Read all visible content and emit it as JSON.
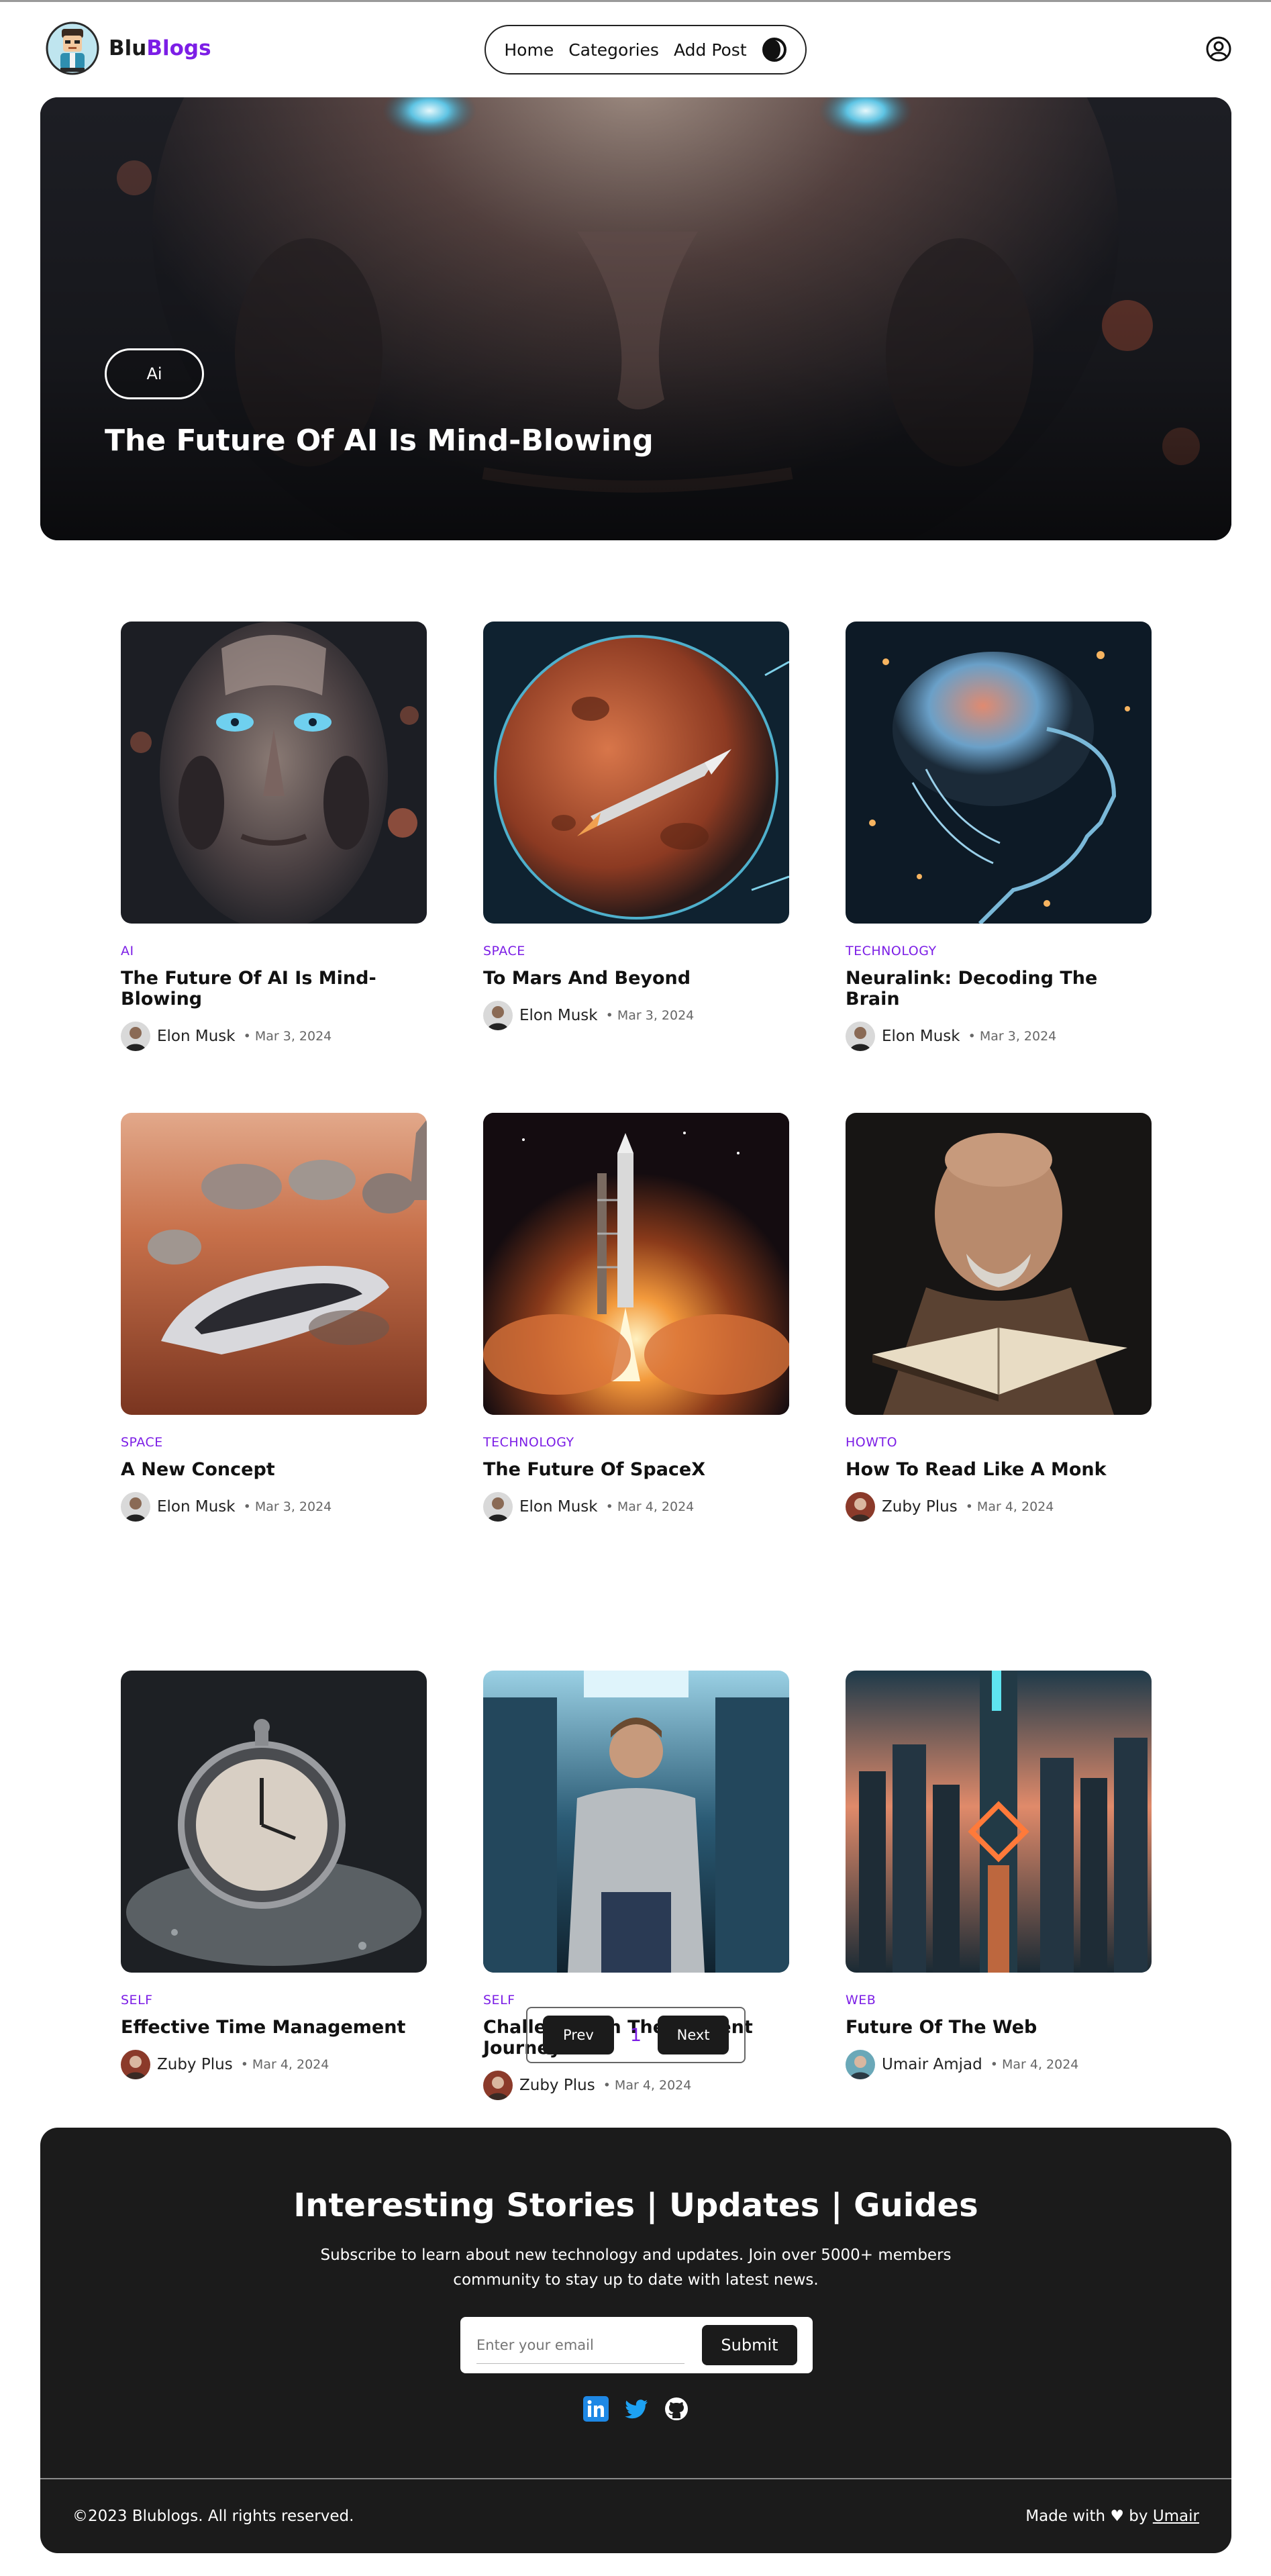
{
  "brand": {
    "name_part1": "Blu",
    "name_part2": "Blogs",
    "accent": "#7c1ee6"
  },
  "nav": {
    "links": [
      "Home",
      "Categories",
      "Add Post"
    ],
    "theme_icon": "dark-mode-icon",
    "user_icon": "user-circle-icon"
  },
  "hero": {
    "badge": "Ai",
    "title": "The Future Of AI Is Mind-Blowing"
  },
  "posts": [
    {
      "category": "AI",
      "title": "The Future Of AI Is Mind-Blowing",
      "author": "Elon Musk",
      "date": "• Mar 3, 2024"
    },
    {
      "category": "SPACE",
      "title": "To Mars And Beyond",
      "author": "Elon Musk",
      "date": "• Mar 3, 2024"
    },
    {
      "category": "TECHNOLOGY",
      "title": "Neuralink: Decoding The Brain",
      "author": "Elon Musk",
      "date": "• Mar 3, 2024"
    },
    {
      "category": "SPACE",
      "title": "A New Concept",
      "author": "Elon Musk",
      "date": "• Mar 3, 2024"
    },
    {
      "category": "TECHNOLOGY",
      "title": "The Future Of SpaceX",
      "author": "Elon Musk",
      "date": "• Mar 4, 2024"
    },
    {
      "category": "HOWTO",
      "title": "How To Read Like A Monk",
      "author": "Zuby Plus",
      "date": "• Mar 4, 2024"
    },
    {
      "category": "SELF",
      "title": "Effective Time Management",
      "author": "Zuby Plus",
      "date": "• Mar 4, 2024"
    },
    {
      "category": "SELF",
      "title": "Challenges In The Student Journey",
      "author": "Zuby Plus",
      "date": "• Mar 4, 2024"
    },
    {
      "category": "WEB",
      "title": "Future Of The Web",
      "author": "Umair Amjad",
      "date": "• Mar 4, 2024"
    }
  ],
  "pagination": {
    "prev": "Prev",
    "current": "1",
    "next": "Next"
  },
  "footer": {
    "heading": "Interesting Stories | Updates | Guides",
    "text": "Subscribe to learn about new technology and updates. Join over 5000+ members community to stay up to date with latest news.",
    "email_placeholder": "Enter your email",
    "submit": "Submit",
    "socials": [
      "linkedin-icon",
      "twitter-icon",
      "github-icon"
    ],
    "copyright": "©2023 Blublogs. All rights reserved.",
    "made_with": "Made with ♥ by",
    "made_by": "Umair"
  }
}
